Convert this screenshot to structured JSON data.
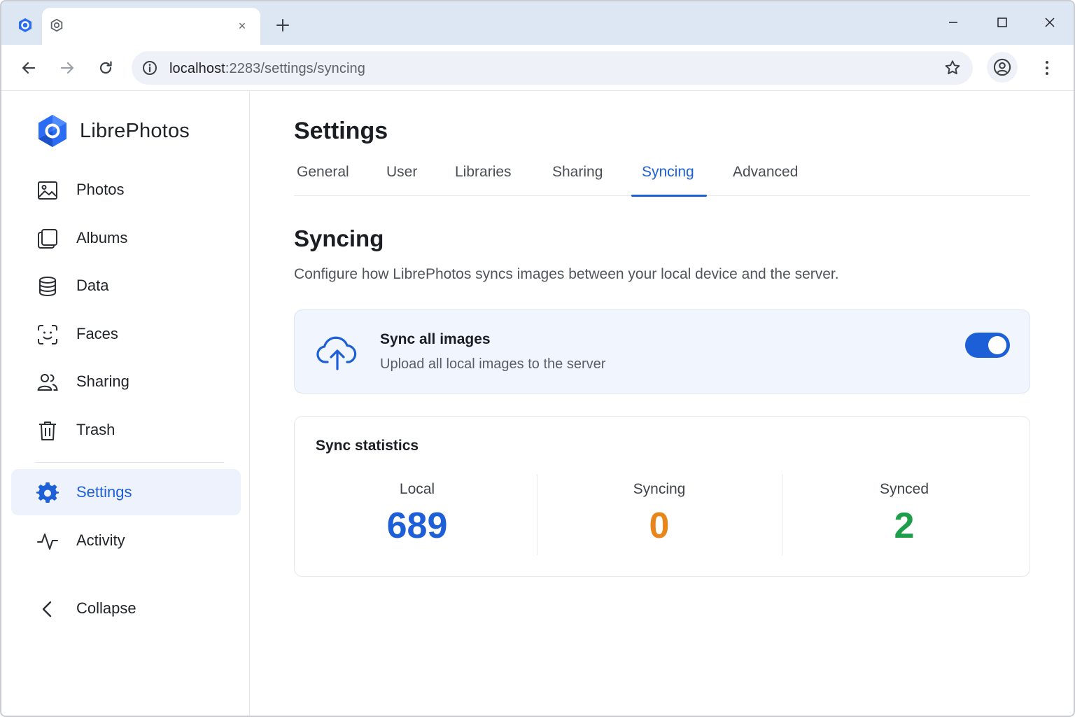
{
  "browser": {
    "tab_close": "×",
    "url_host": "localhost",
    "url_path": ":2283/settings/syncing",
    "icons": {
      "back": "arrow-left-icon",
      "forward": "arrow-right-icon",
      "reload": "reload-icon",
      "info": "info-icon",
      "star": "star-icon",
      "profile": "profile-icon",
      "menu": "kebab-menu-icon",
      "new_tab": "plus-icon"
    }
  },
  "sidebar": {
    "brand": "LibrePhotos",
    "items": [
      {
        "label": "Photos",
        "icon": "image-icon"
      },
      {
        "label": "Albums",
        "icon": "albums-icon"
      },
      {
        "label": "Data",
        "icon": "database-icon"
      },
      {
        "label": "Faces",
        "icon": "face-scan-icon"
      },
      {
        "label": "Sharing",
        "icon": "users-icon"
      },
      {
        "label": "Trash",
        "icon": "trash-icon"
      }
    ],
    "secondary": [
      {
        "label": "Settings",
        "icon": "gear-icon",
        "active": true
      },
      {
        "label": "Activity",
        "icon": "activity-icon"
      }
    ],
    "collapse": {
      "label": "Collapse",
      "icon": "chevron-left-icon"
    }
  },
  "main": {
    "title": "Settings",
    "tabs": [
      {
        "label": "General"
      },
      {
        "label": "User"
      },
      {
        "label": "Libraries"
      },
      {
        "label": "Sharing"
      },
      {
        "label": "Syncing",
        "active": true
      },
      {
        "label": "Advanced"
      }
    ],
    "section": {
      "title": "Syncing",
      "description": "Configure how LibrePhotos syncs images between your local device and the server."
    },
    "sync_all": {
      "title": "Sync all images",
      "subtitle": "Upload all local images to the server",
      "enabled": true,
      "icon": "cloud-upload-icon"
    },
    "stats": {
      "title": "Sync statistics",
      "items": [
        {
          "label": "Local",
          "value": "689",
          "color": "#1d5fd6"
        },
        {
          "label": "Syncing",
          "value": "0",
          "color": "#e8861a"
        },
        {
          "label": "Synced",
          "value": "2",
          "color": "#1e9e4a"
        }
      ]
    }
  },
  "colors": {
    "accent": "#1d5fd6",
    "titlebar": "#dde6f3"
  }
}
